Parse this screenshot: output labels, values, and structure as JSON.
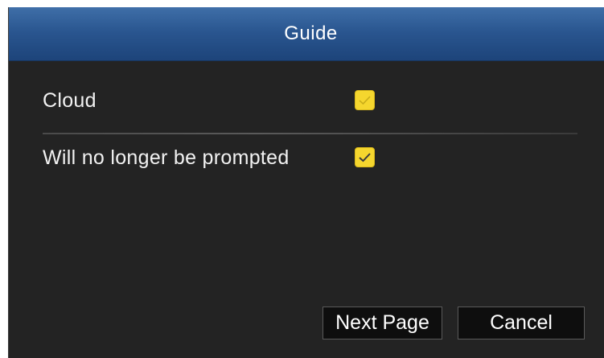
{
  "dialog": {
    "title": "Guide"
  },
  "options": {
    "cloud": {
      "label": "Cloud",
      "checked": true
    },
    "no_prompt": {
      "label": "Will no longer be prompted",
      "checked": true
    }
  },
  "buttons": {
    "next_label": "Next Page",
    "cancel_label": "Cancel"
  },
  "colors": {
    "titlebar": "#2a5690",
    "background": "#232323",
    "checkbox": "#f5d62e",
    "button_bg": "#0e0e0e"
  },
  "icons": {
    "checkbox_check": "check-icon"
  }
}
